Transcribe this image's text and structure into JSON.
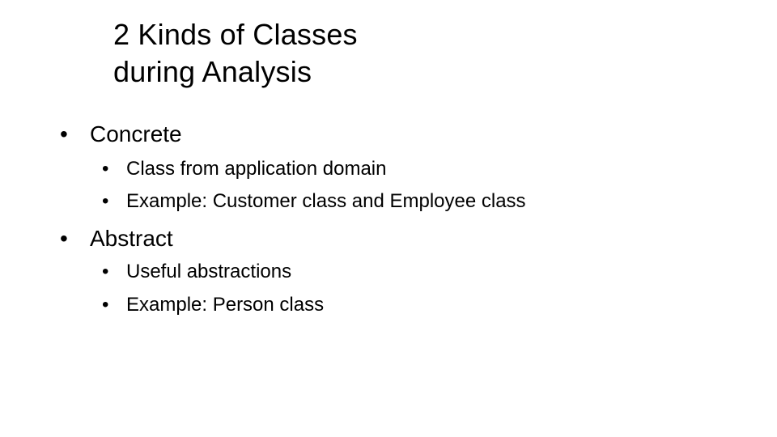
{
  "slide": {
    "title_lines": [
      "2 Kinds of Classes",
      "during Analysis"
    ],
    "bullets": [
      {
        "label": "Concrete",
        "sub": [
          "Class from application domain",
          "Example:  Customer class and Employee class"
        ]
      },
      {
        "label": "Abstract",
        "sub": [
          "Useful abstractions",
          "Example:  Person class"
        ]
      }
    ],
    "bullet_glyph": "•"
  }
}
